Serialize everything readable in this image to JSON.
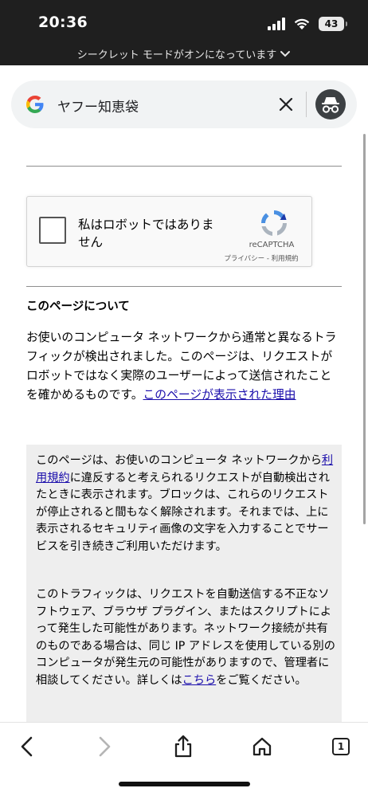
{
  "status": {
    "time": "20:36",
    "battery": "43"
  },
  "incognito_banner": {
    "label": "シークレット モードがオンになっています"
  },
  "search": {
    "query": "ヤフー知恵袋"
  },
  "captcha": {
    "label": "私はロボットではありません",
    "brand": "reCAPTCHA",
    "links": "プライバシー - 利用規約"
  },
  "about": {
    "title": "このページについて",
    "body": "お使いのコンピュータ ネットワークから通常と異なるトラフィックが検出されました。このページは、リクエストがロボットではなく実際のユーザーによって送信されたことを確かめるものです。",
    "link": "このページが表示された理由"
  },
  "info": {
    "p1_before": "このページは、お使いのコンピュータ ネットワークから",
    "p1_link": "利用規約",
    "p1_after": "に違反すると考えられるリクエストが自動検出されたときに表示されます。ブロックは、これらのリクエストが停止されると間もなく解除されます。それまでは、上に表示されるセキュリティ画像の文字を入力することでサービスを引き続きご利用いただけます。",
    "p2_before": "このトラフィックは、リクエストを自動送信する不正なソフトウェア、ブラウザ プラグイン、またはスクリプトによって発生した可能性があります。ネットワーク接続が共有のものである場合は、同じ IP アドレスを使用している別のコンピュータが発生元の可能性がありますので、管理者に相談してください。詳しくは",
    "p2_link": "こちら",
    "p2_after": "をご覧ください。"
  },
  "toolbar": {
    "tab_count": "1"
  }
}
